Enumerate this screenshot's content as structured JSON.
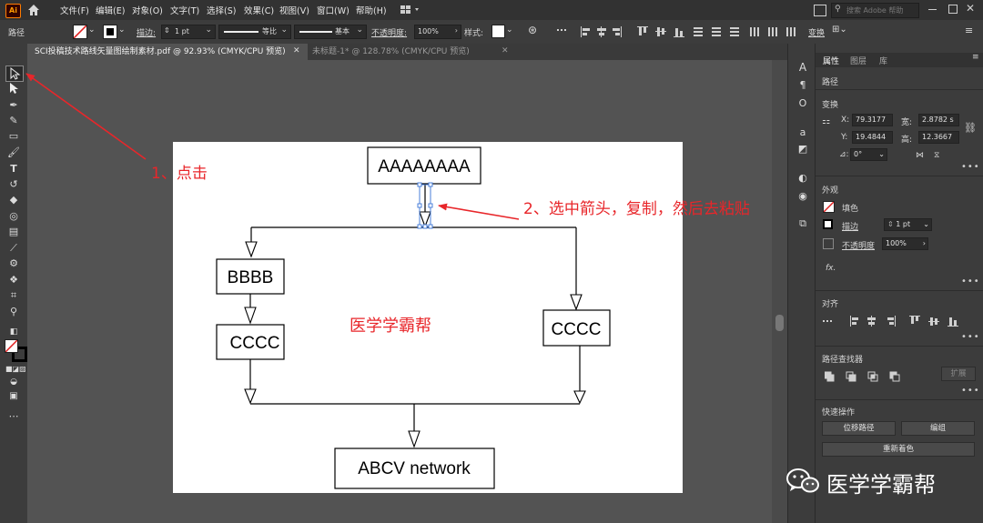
{
  "app": {
    "logo": "Ai"
  },
  "menu": {
    "items": [
      "文件(F)",
      "编辑(E)",
      "对象(O)",
      "文字(T)",
      "选择(S)",
      "效果(C)",
      "视图(V)",
      "窗口(W)",
      "帮助(H)"
    ],
    "search_placeholder": "搜索 Adobe 帮助"
  },
  "control_bar": {
    "object_type": "路径",
    "stroke_label": "描边:",
    "stroke_value": "1 pt",
    "profile_label": "等比",
    "brush_label": "基本",
    "opacity_label": "不透明度:",
    "opacity_value": "100%",
    "style_label": "样式:",
    "transform_label": "变换"
  },
  "tabs": [
    {
      "label": "SCI投稿技术路线矢量图绘制素材.pdf @ 92.93% (CMYK/CPU 预览)",
      "active": true
    },
    {
      "label": "未标题-1* @ 128.78% (CMYK/CPU 预览)",
      "active": false
    }
  ],
  "diagram": {
    "top_box": "AAAAAAAA",
    "left_box_1": "BBBB",
    "left_box_2": "CCCC",
    "right_box": "CCCC",
    "bottom_box": "ABCV network",
    "center_label": "医学学霸帮"
  },
  "annotations": {
    "step1": "1、点击",
    "step2": "2、选中箭头，复制，然后去粘贴",
    "color": "#e8262a"
  },
  "panel": {
    "tabs": [
      "属性",
      "图层",
      "库"
    ],
    "path_label": "路径",
    "transform_title": "变换",
    "x_label": "X:",
    "x_value": "79.3177",
    "y_label": "Y:",
    "y_value": "19.4844",
    "w_label": "宽:",
    "w_value": "2.8782 s",
    "h_label": "高:",
    "h_value": "12.3667",
    "angle_label": "⊿:",
    "angle_value": "0°",
    "appearance_title": "外观",
    "fill_label": "填色",
    "stroke_label": "描边",
    "stroke_value": "1 pt",
    "opacity_label": "不透明度",
    "opacity_value": "100%",
    "fx_label": "fx.",
    "align_title": "对齐",
    "pathfinder_title": "路径查找器",
    "expand_label": "扩展",
    "quick_actions_title": "快速操作",
    "offset_path_button": "位移路径",
    "group_button": "编组",
    "recolor_button": "重新着色"
  },
  "watermark": {
    "text": "医学学霸帮"
  }
}
